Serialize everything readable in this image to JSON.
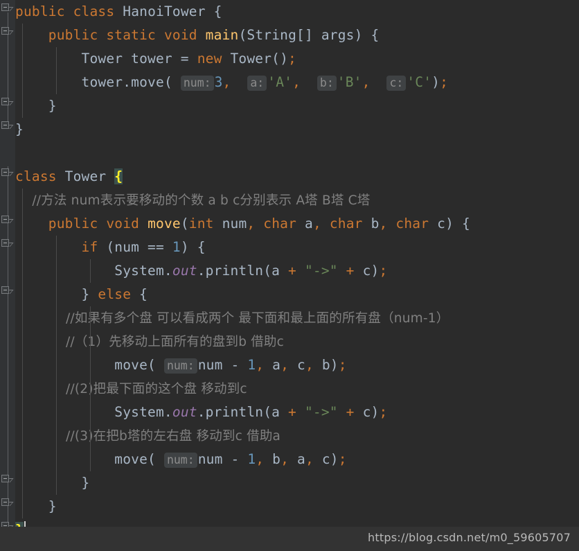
{
  "editor": {
    "theme": "darcula",
    "background": "#2b2b2b",
    "gutter_background": "#313335",
    "default_text_color": "#a9b7c6",
    "keyword_color": "#cc7832",
    "string_color": "#6a8759",
    "number_color": "#6897bb",
    "comment_color": "#808080",
    "method_color": "#ffc66d",
    "static_field_color": "#9876aa",
    "brace_match_background": "#3b514d",
    "brace_match_color": "#ffef28",
    "hint_background": "#3f4244",
    "hint_color": "#8c8c8c"
  },
  "code": {
    "language": "Java",
    "lines": [
      {
        "n": 1,
        "text": "public class HanoiTower {",
        "tokens": [
          {
            "t": "public",
            "c": "kw"
          },
          {
            "t": " ",
            "c": "punc"
          },
          {
            "t": "class",
            "c": "kw"
          },
          {
            "t": " ",
            "c": "punc"
          },
          {
            "t": "HanoiTower",
            "c": "type"
          },
          {
            "t": " {",
            "c": "punc"
          }
        ]
      },
      {
        "n": 2,
        "text": "    public static void main(String[] args) {",
        "tokens": [
          {
            "t": "    ",
            "c": "punc"
          },
          {
            "t": "public",
            "c": "kw"
          },
          {
            "t": " ",
            "c": "punc"
          },
          {
            "t": "static",
            "c": "kw"
          },
          {
            "t": " ",
            "c": "punc"
          },
          {
            "t": "void",
            "c": "kw"
          },
          {
            "t": " ",
            "c": "punc"
          },
          {
            "t": "main",
            "c": "mdecl"
          },
          {
            "t": "(String[] args) {",
            "c": "punc"
          }
        ]
      },
      {
        "n": 3,
        "text": "        Tower tower = new Tower();",
        "tokens": [
          {
            "t": "        Tower tower = ",
            "c": "punc"
          },
          {
            "t": "new",
            "c": "kw"
          },
          {
            "t": " Tower()",
            "c": "punc"
          },
          {
            "t": ";",
            "c": "semi"
          }
        ]
      },
      {
        "n": 4,
        "text": "        tower.move( num: 3,  a: 'A',  b: 'B',  c: 'C');",
        "hints": [
          "num:",
          "a:",
          "b:",
          "c:"
        ],
        "tokens": []
      },
      {
        "n": 5,
        "text": "    }",
        "tokens": [
          {
            "t": "    }",
            "c": "punc"
          }
        ]
      },
      {
        "n": 6,
        "text": "}",
        "tokens": [
          {
            "t": "}",
            "c": "punc"
          }
        ]
      },
      {
        "n": 7,
        "text": "",
        "tokens": []
      },
      {
        "n": 8,
        "text": "class Tower {",
        "brace_highlight": "{",
        "tokens": [
          {
            "t": "class",
            "c": "kw"
          },
          {
            "t": " ",
            "c": "punc"
          },
          {
            "t": "Tower",
            "c": "type"
          },
          {
            "t": " ",
            "c": "punc"
          }
        ]
      },
      {
        "n": 9,
        "text": "    //方法 num表示要移动的个数 a b c分别表示 A塔 B塔 C塔",
        "comment": true
      },
      {
        "n": 10,
        "text": "    public void move(int num, char a, char b, char c) {",
        "tokens": [
          {
            "t": "    ",
            "c": "punc"
          },
          {
            "t": "public",
            "c": "kw"
          },
          {
            "t": " ",
            "c": "punc"
          },
          {
            "t": "void",
            "c": "kw"
          },
          {
            "t": " ",
            "c": "punc"
          },
          {
            "t": "move",
            "c": "mdecl"
          },
          {
            "t": "(",
            "c": "punc"
          },
          {
            "t": "int",
            "c": "kw"
          },
          {
            "t": " num",
            "c": "punc"
          },
          {
            "t": ",",
            "c": "comma"
          },
          {
            "t": " ",
            "c": "punc"
          },
          {
            "t": "char",
            "c": "kw"
          },
          {
            "t": " a",
            "c": "punc"
          },
          {
            "t": ",",
            "c": "comma"
          },
          {
            "t": " ",
            "c": "punc"
          },
          {
            "t": "char",
            "c": "kw"
          },
          {
            "t": " b",
            "c": "punc"
          },
          {
            "t": ",",
            "c": "comma"
          },
          {
            "t": " ",
            "c": "punc"
          },
          {
            "t": "char",
            "c": "kw"
          },
          {
            "t": " c) {",
            "c": "punc"
          }
        ]
      },
      {
        "n": 11,
        "text": "        if (num == 1) {",
        "tokens": [
          {
            "t": "        ",
            "c": "punc"
          },
          {
            "t": "if",
            "c": "kw"
          },
          {
            "t": " (num == ",
            "c": "punc"
          },
          {
            "t": "1",
            "c": "num"
          },
          {
            "t": ") {",
            "c": "punc"
          }
        ]
      },
      {
        "n": 12,
        "text": "            System.out.println(a + \"->\" + c);",
        "tokens": [
          {
            "t": "            System.",
            "c": "punc"
          },
          {
            "t": "out",
            "c": "sfield"
          },
          {
            "t": ".println(a ",
            "c": "punc"
          },
          {
            "t": "+",
            "c": "kw"
          },
          {
            "t": " ",
            "c": "punc"
          },
          {
            "t": "\"->\"",
            "c": "str"
          },
          {
            "t": " ",
            "c": "punc"
          },
          {
            "t": "+",
            "c": "kw"
          },
          {
            "t": " c)",
            "c": "punc"
          },
          {
            "t": ";",
            "c": "semi"
          }
        ]
      },
      {
        "n": 13,
        "text": "        } else {",
        "tokens": [
          {
            "t": "        } ",
            "c": "punc"
          },
          {
            "t": "else",
            "c": "kw"
          },
          {
            "t": " {",
            "c": "punc"
          }
        ]
      },
      {
        "n": 14,
        "text": "            //如果有多个盘 可以看成两个 最下面和最上面的所有盘（num-1）",
        "comment": true
      },
      {
        "n": 15,
        "text": "            //（1）先移动上面所有的盘到b 借助c",
        "comment": true
      },
      {
        "n": 16,
        "text": "            move( num: num - 1, a, c, b);",
        "hints": [
          "num:"
        ],
        "tokens": []
      },
      {
        "n": 17,
        "text": "            //(2)把最下面的这个盘 移动到c",
        "comment": true
      },
      {
        "n": 18,
        "text": "            System.out.println(a + \"->\" + c);",
        "tokens": [
          {
            "t": "            System.",
            "c": "punc"
          },
          {
            "t": "out",
            "c": "sfield"
          },
          {
            "t": ".println(a ",
            "c": "punc"
          },
          {
            "t": "+",
            "c": "kw"
          },
          {
            "t": " ",
            "c": "punc"
          },
          {
            "t": "\"->\"",
            "c": "str"
          },
          {
            "t": " ",
            "c": "punc"
          },
          {
            "t": "+",
            "c": "kw"
          },
          {
            "t": " c)",
            "c": "punc"
          },
          {
            "t": ";",
            "c": "semi"
          }
        ]
      },
      {
        "n": 19,
        "text": "            //(3)在把b塔的左右盘 移动到c 借助a",
        "comment": true
      },
      {
        "n": 20,
        "text": "            move( num: num - 1, b, a, c);",
        "hints": [
          "num:"
        ],
        "tokens": []
      },
      {
        "n": 21,
        "text": "        }",
        "tokens": [
          {
            "t": "        }",
            "c": "punc"
          }
        ]
      },
      {
        "n": 22,
        "text": "    }",
        "tokens": [
          {
            "t": "    }",
            "c": "punc"
          }
        ]
      },
      {
        "n": 23,
        "text": "}",
        "brace_highlight": "}",
        "caret": true,
        "tokens": []
      }
    ]
  },
  "lines": {
    "l1_public": "public",
    "l1_class": "class",
    "l1_name": "HanoiTower",
    "l1_brace": " {",
    "l2_indent": "    ",
    "l2_public": "public",
    "l2_static": "static",
    "l2_void": "void",
    "l2_main": "main",
    "l2_sig": "(String[] args) {",
    "l3_a": "        Tower tower = ",
    "l3_new": "new",
    "l3_b": " Tower()",
    "l3_semi": ";",
    "l4_a": "        tower.",
    "l4_move": "move",
    "l4_paren": "( ",
    "l4_hint_num": "num:",
    "l4_num": "3",
    "l4_c1": ",",
    "l4_sp1": "  ",
    "l4_hint_a": "a:",
    "l4_str_a": "'A'",
    "l4_c2": ",",
    "l4_sp2": "  ",
    "l4_hint_b": "b:",
    "l4_str_b": "'B'",
    "l4_c3": ",",
    "l4_sp3": "  ",
    "l4_hint_c": "c:",
    "l4_str_c": "'C'",
    "l4_close": ")",
    "l4_semi": ";",
    "l5": "    }",
    "l6": "}",
    "l8_class": "class",
    "l8_name": " Tower ",
    "l8_brace": "{",
    "l9": "    //方法 num表示要移动的个数 a b c分别表示 A塔 B塔 C塔",
    "l10_indent": "    ",
    "l10_public": "public",
    "l10_void": "void",
    "l10_move": "move",
    "l10_p1": "(",
    "l10_int": "int",
    "l10_num": " num",
    "l10_c1": ",",
    "l10_char1": "char",
    "l10_a": " a",
    "l10_c2": ",",
    "l10_char2": "char",
    "l10_b": " b",
    "l10_c3": ",",
    "l10_char3": "char",
    "l10_end": " c) {",
    "l11_indent": "        ",
    "l11_if": "if",
    "l11_cond": " (num == ",
    "l11_one": "1",
    "l11_end": ") {",
    "l12_a": "            System.",
    "l12_out": "out",
    "l12_b": ".println(a ",
    "l12_plus1": "+",
    "l12_str": "\"->\"",
    "l12_plus2": "+",
    "l12_c": " c)",
    "l12_semi": ";",
    "l13_a": "        } ",
    "l13_else": "else",
    "l13_b": " {",
    "l14": "            //如果有多个盘 可以看成两个 最下面和最上面的所有盘（num-1）",
    "l15": "            //（1）先移动上面所有的盘到b 借助c",
    "l16_indent": "            ",
    "l16_move": "move",
    "l16_paren": "( ",
    "l16_hint": "num:",
    "l16_expr": "num - ",
    "l16_one": "1",
    "l16_c1": ",",
    "l16_a": " a",
    "l16_c2": ",",
    "l16_c": " c",
    "l16_c3": ",",
    "l16_b": " b)",
    "l16_semi": ";",
    "l17": "            //(2)把最下面的这个盘 移动到c",
    "l18_a": "            System.",
    "l18_out": "out",
    "l18_b": ".println(a ",
    "l18_plus1": "+",
    "l18_str": "\"->\"",
    "l18_plus2": "+",
    "l18_c": " c)",
    "l18_semi": ";",
    "l19": "            //(3)在把b塔的左右盘 移动到c 借助a",
    "l20_indent": "            ",
    "l20_move": "move",
    "l20_paren": "( ",
    "l20_hint": "num:",
    "l20_expr": "num - ",
    "l20_one": "1",
    "l20_c1": ",",
    "l20_b": " b",
    "l20_c2": ",",
    "l20_a": " a",
    "l20_c3": ",",
    "l20_c": " c)",
    "l20_semi": ";",
    "l21": "        }",
    "l22": "    }",
    "l23": "}"
  },
  "watermark": {
    "url": "https://blog.csdn.net/m0_59605707"
  }
}
